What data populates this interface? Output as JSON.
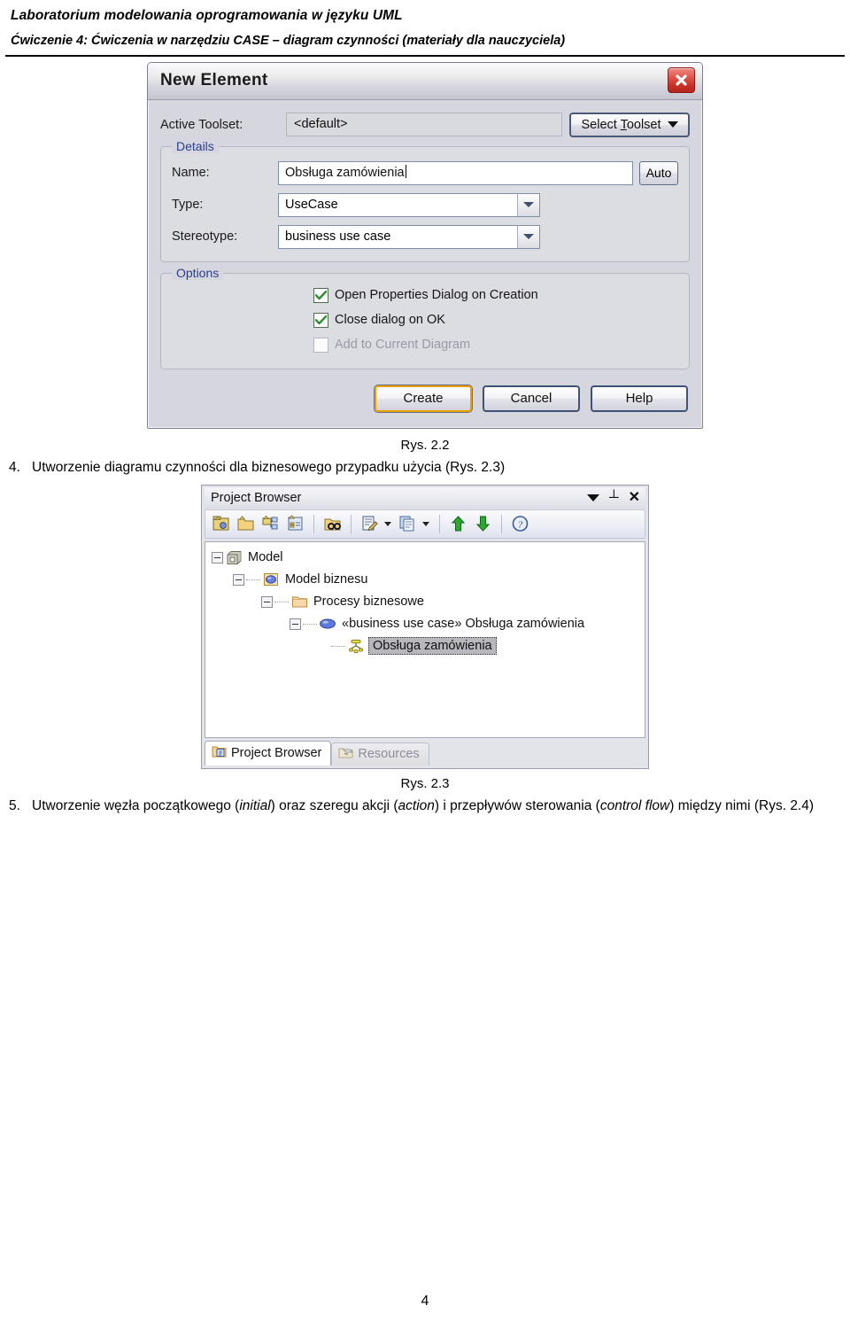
{
  "header": {
    "line1": "Laboratorium modelowania oprogramowania w języku UML",
    "line2": "Ćwiczenie 4: Ćwiczenia w narzędziu CASE – diagram czynności (materiały dla nauczyciela)"
  },
  "dialog": {
    "title": "New Element",
    "close_icon": "close-icon",
    "toolset": {
      "label": "Active Toolset:",
      "value": "<default>",
      "button_pre": "Select ",
      "button_underline": "T",
      "button_post": "oolset"
    },
    "details": {
      "title": "Details",
      "name_label": "Name:",
      "name_value": "Obsługa zamówienia",
      "auto_button": "Auto",
      "type_label": "Type:",
      "type_value": "UseCase",
      "stereotype_label": "Stereotype:",
      "stereotype_value": "business use case"
    },
    "options": {
      "title": "Options",
      "items": [
        {
          "label": "Open Properties Dialog on Creation",
          "checked": true,
          "enabled": true
        },
        {
          "label": "Close dialog on OK",
          "checked": true,
          "enabled": true
        },
        {
          "label": "Add to Current Diagram",
          "checked": false,
          "enabled": false
        }
      ]
    },
    "buttons": {
      "create": "Create",
      "cancel": "Cancel",
      "help": "Help"
    }
  },
  "caption_22": "Rys. 2.2",
  "item4": {
    "num": "4.",
    "text": "Utworzenie diagramu czynności dla biznesowego przypadku użycia (Rys. 2.3)"
  },
  "project_browser": {
    "title": "Project Browser",
    "controls": [
      "chevron-down-icon",
      "pin-icon",
      "close-icon"
    ],
    "toolbar_icons": [
      "new-package-icon",
      "new-folder-icon",
      "new-element-icon",
      "new-diagram-icon",
      "find-package-icon",
      "edit-properties-icon",
      "copy-icon",
      "move-up-icon",
      "move-down-icon",
      "help-icon"
    ],
    "tree": [
      {
        "label": "Model",
        "depth": 0,
        "icon": "model-root-icon",
        "expander": "minus",
        "selected": false
      },
      {
        "label": "Model biznesu",
        "depth": 1,
        "icon": "view-icon",
        "expander": "minus",
        "selected": false
      },
      {
        "label": "Procesy biznesowe",
        "depth": 2,
        "icon": "folder-icon",
        "expander": "minus",
        "selected": false
      },
      {
        "label": "«business use case» Obsługa zamówienia",
        "depth": 3,
        "icon": "usecase-icon",
        "expander": "minus",
        "selected": false
      },
      {
        "label": "Obsługa zamówienia",
        "depth": 4,
        "icon": "activity-diagram-icon",
        "expander": "none",
        "selected": true
      }
    ],
    "tabs": [
      {
        "label": "Project Browser",
        "icon": "project-browser-icon",
        "active": true
      },
      {
        "label": "Resources",
        "icon": "resources-icon",
        "active": false
      }
    ]
  },
  "caption_23": "Rys. 2.3",
  "item5": {
    "num": "5.",
    "part1": "Utworzenie węzła początkowego (",
    "em1": "initial",
    "part2": ") oraz szeregu akcji (",
    "em2": "action",
    "part3": ") i przepływów sterowania (",
    "em3": "control flow",
    "part4": ") między nimi (Rys. 2.4)"
  },
  "page_number": "4",
  "colors": {
    "accent_blue": "#2a3f8f",
    "close_red": "#c62f26",
    "default_button": "#e8a200",
    "check_green": "#2e8b2e"
  }
}
